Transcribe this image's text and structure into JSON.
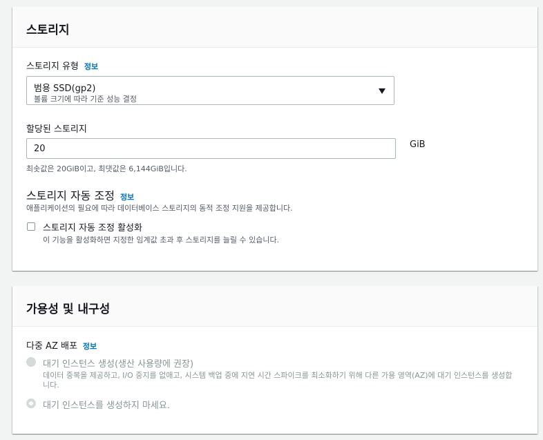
{
  "storage": {
    "title": "스토리지",
    "storage_type": {
      "label": "스토리지 유형",
      "info": "정보",
      "selected_value": "범용 SSD(gp2)",
      "selected_description": "볼륨 크기에 따라 기준 성능 결정"
    },
    "allocated": {
      "label": "할당된 스토리지",
      "value": "20",
      "unit": "GiB",
      "hint": "최솟값은 20GiB이고, 최댓값은 6,144GiB입니다."
    },
    "autoscaling": {
      "heading": "스토리지 자동 조정",
      "info": "정보",
      "description": "애플리케이션의 필요에 따라 데이터베이스 스토리지의 동적 조정 지원을 제공합니다.",
      "checkbox_label": "스토리지 자동 조정 활성화",
      "checkbox_description": "이 기능을 활성화하면 지정한 임계값 초과 후 스토리지를 늘릴 수 있습니다.",
      "checked": false
    }
  },
  "availability": {
    "title": "가용성 및 내구성",
    "multi_az": {
      "label": "다중 AZ 배포",
      "info": "정보",
      "options": [
        {
          "label": "대기 인스턴스 생성(생산 사용량에 권장)",
          "description_line1": "데이터 중복을 제공하고, I/O 중지를 없애고, 시스템 백업 중에 지연 시간 스파이크를 최소화하기 위해 다른 가용 영역(AZ)에 대기 인스턴스를 생성합",
          "description_line2": "니다.",
          "selected": false,
          "disabled": true
        },
        {
          "label": "대기 인스턴스를 생성하지 마세요.",
          "selected": true,
          "disabled": true
        }
      ]
    }
  },
  "colors": {
    "link": "#0073bb",
    "background": "#f2f3f3",
    "panel": "#ffffff",
    "header": "#fafafa",
    "disabled": "#879596"
  }
}
